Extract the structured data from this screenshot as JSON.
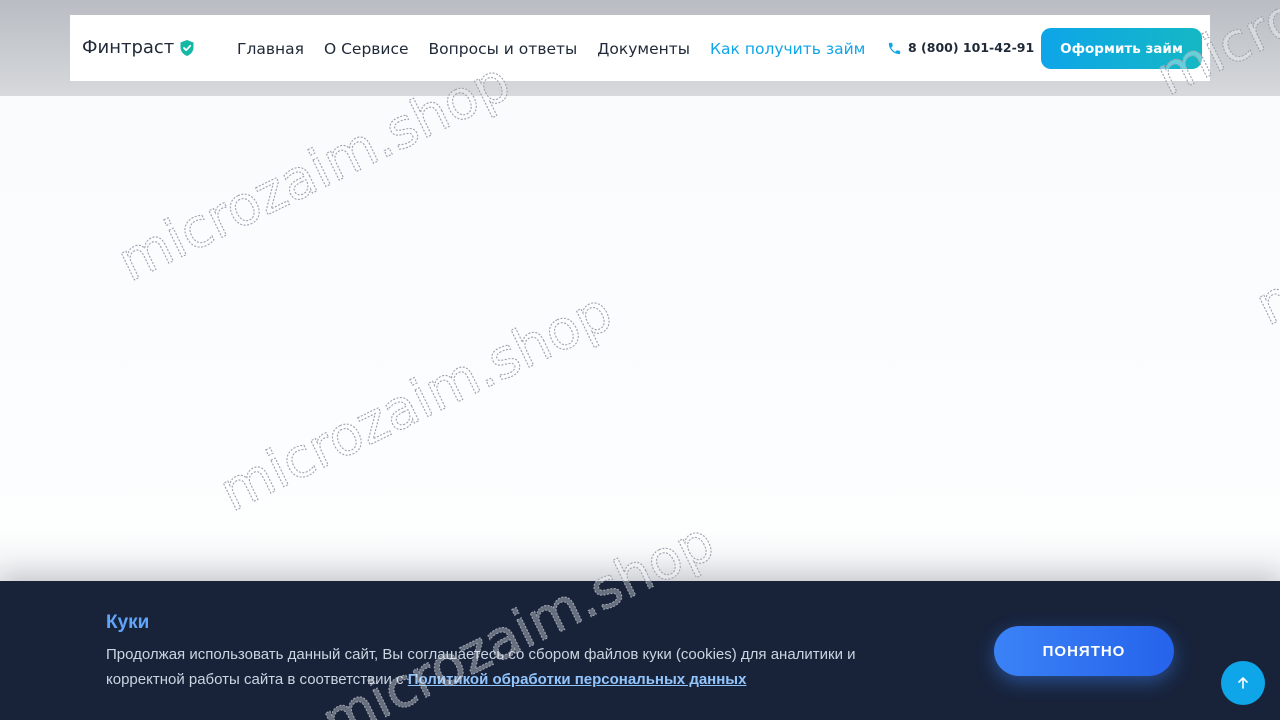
{
  "header": {
    "logo_text": "Финтраст",
    "logo_icon": "shield-check-icon",
    "nav": [
      {
        "label": "Главная",
        "active": false
      },
      {
        "label": "О Сервисе",
        "active": false
      },
      {
        "label": "Вопросы и ответы",
        "active": false
      },
      {
        "label": "Документы",
        "active": false
      },
      {
        "label": "Как получить займ",
        "active": true
      }
    ],
    "phone_icon": "phone-icon",
    "phone": "8 (800) 101-42-91",
    "cta_label": "Оформить займ"
  },
  "cookie_banner": {
    "title": "Куки",
    "text": "Продолжая использовать данный сайт, Вы соглашаетесь со сбором файлов куки (cookies) для аналитики и корректной работы сайта в соответствии с ",
    "link_text": "Политикой обработки персональных данных",
    "accept_label": "ПОНЯТНО"
  },
  "scroll_top_icon": "arrow-up-icon",
  "watermark_text": "microzaim.shop",
  "colors": {
    "accent": "#0ea5e9",
    "cta_gradient_end": "#14b8c4",
    "cookie_bg": "#18233a",
    "cookie_title": "#60a5fa",
    "accept_button": "#3b82f6",
    "shield": "#14b8a6"
  }
}
